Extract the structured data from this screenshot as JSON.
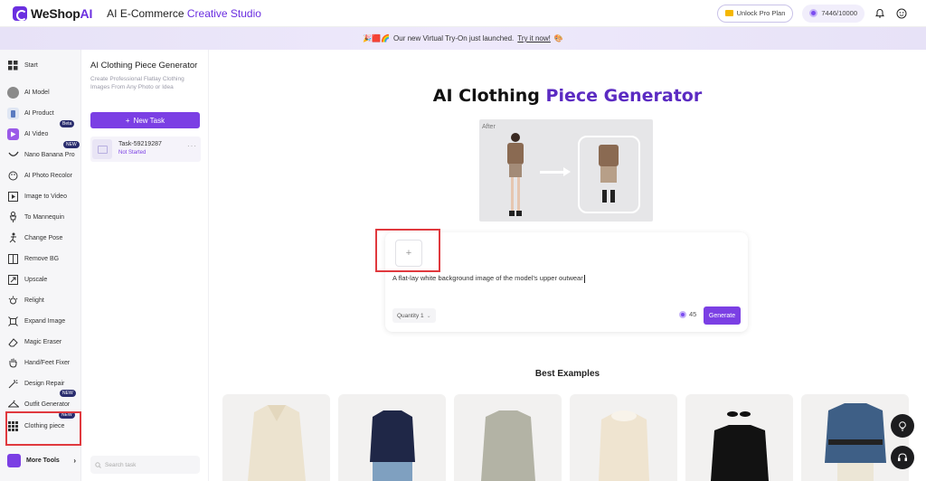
{
  "header": {
    "logo_prefix": "WeShop",
    "logo_suffix": "AI",
    "studio_prefix": "AI E-Commerce",
    "studio_accent": "Creative Studio",
    "pro_button": "Unlock Pro Plan",
    "credits": "7446/10000"
  },
  "banner": {
    "text": "Our new Virtual Try-On just launched.",
    "link": "Try it now!"
  },
  "nav": {
    "items": [
      {
        "label": "Start",
        "icon": "grid-icon"
      },
      {
        "label": "AI Model",
        "icon": "model-avatar-icon"
      },
      {
        "label": "AI Product",
        "icon": "product-icon"
      },
      {
        "label": "AI Video",
        "icon": "video-icon",
        "badge": "Beta"
      },
      {
        "label": "Nano Banana Pro",
        "icon": "banana-icon",
        "badge": "NEW"
      },
      {
        "label": "AI Photo Recolor",
        "icon": "palette-icon"
      },
      {
        "label": "Image to Video",
        "icon": "film-icon"
      },
      {
        "label": "To Mannequin",
        "icon": "mannequin-icon"
      },
      {
        "label": "Change Pose",
        "icon": "pose-icon"
      },
      {
        "label": "Remove BG",
        "icon": "remove-bg-icon"
      },
      {
        "label": "Upscale",
        "icon": "upscale-icon"
      },
      {
        "label": "Relight",
        "icon": "bulb-icon"
      },
      {
        "label": "Expand Image",
        "icon": "expand-icon"
      },
      {
        "label": "Magic Eraser",
        "icon": "eraser-icon"
      },
      {
        "label": "Hand/Feet Fixer",
        "icon": "hand-icon"
      },
      {
        "label": "Design Repair",
        "icon": "wand-icon"
      },
      {
        "label": "Outfit Generator",
        "icon": "hanger-icon",
        "badge": "NEW"
      },
      {
        "label": "Clothing piece",
        "icon": "grid-dots-icon",
        "badge": "NEW"
      }
    ],
    "more_tools": "More Tools"
  },
  "tasks": {
    "title": "AI Clothing Piece Generator",
    "description": "Create Professional Flatlay Clothing Images From Any Photo or Idea",
    "new_task": "New Task",
    "task_name": "Task-59219287",
    "task_status": "Not Started",
    "search_placeholder": "Search task"
  },
  "main": {
    "title_plain": "AI Clothing",
    "title_accent1": "Piece",
    "title_accent2": "Generator",
    "preview_label": "After",
    "upload_symbol": "+",
    "prompt": "A flat-lay white background image of the model's upper outwear",
    "quantity": "Quantity 1",
    "cost": "45",
    "generate": "Generate",
    "examples_title": "Best Examples"
  },
  "colors": {
    "brand": "#7b3fe4",
    "highlight": "#e0393e"
  }
}
